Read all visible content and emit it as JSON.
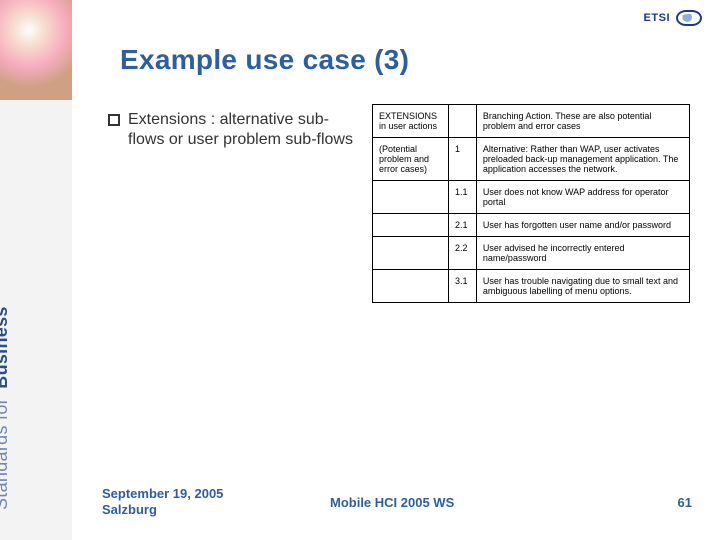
{
  "brand": {
    "logo_text": "ETSI"
  },
  "sidebar": {
    "tagline_left": "Standards for",
    "tagline_right": "Business"
  },
  "title": "Example use case (3)",
  "bullet": {
    "text": "Extensions : alternative sub-flows or user problem sub-flows"
  },
  "table": {
    "header": {
      "col0": "EXTENSIONS in user actions",
      "col2": "Branching Action. These are also potential problem and error cases"
    },
    "rows": [
      {
        "col0": "(Potential problem and error cases)",
        "col1": "1",
        "col2": "Alternative: Rather than WAP, user activates preloaded back-up management application. The application accesses the network."
      },
      {
        "col0": "",
        "col1": "1.1",
        "col2": "User does not know WAP address for operator portal"
      },
      {
        "col0": "",
        "col1": "2.1",
        "col2": "User has forgotten user name and/or password"
      },
      {
        "col0": "",
        "col1": "2.2",
        "col2": "User advised he incorrectly entered name/password"
      },
      {
        "col0": "",
        "col1": "3.1",
        "col2": "User has trouble navigating due to small text and ambiguous labelling of menu options."
      }
    ]
  },
  "footer": {
    "date": "September 19, 2005",
    "place": "Salzburg",
    "center": "Mobile HCI 2005 WS",
    "page": "61"
  }
}
